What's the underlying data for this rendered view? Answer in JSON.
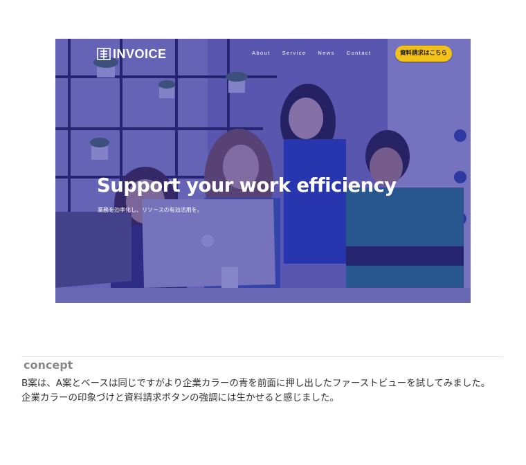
{
  "hero": {
    "logo_text": "INVOICE",
    "logo_icon": "invoice-logo-icon",
    "nav": [
      "About",
      "Service",
      "News",
      "Contact"
    ],
    "cta_label": "資料請求はこちら",
    "headline": "Support your work efficiency",
    "subline": "業務を効率化し、リソースの有効活用を。",
    "overlay_color": "#302ea8",
    "cta_color": "#f2c21a"
  },
  "concept": {
    "heading": "concept",
    "paragraph_1": "B案は、A案とベースは同じですがより企業カラーの青を前面に押し出したファーストビューを試してみました。",
    "paragraph_2": "企業カラーの印象づけと資料請求ボタンの強調には生かせると感じました。"
  }
}
